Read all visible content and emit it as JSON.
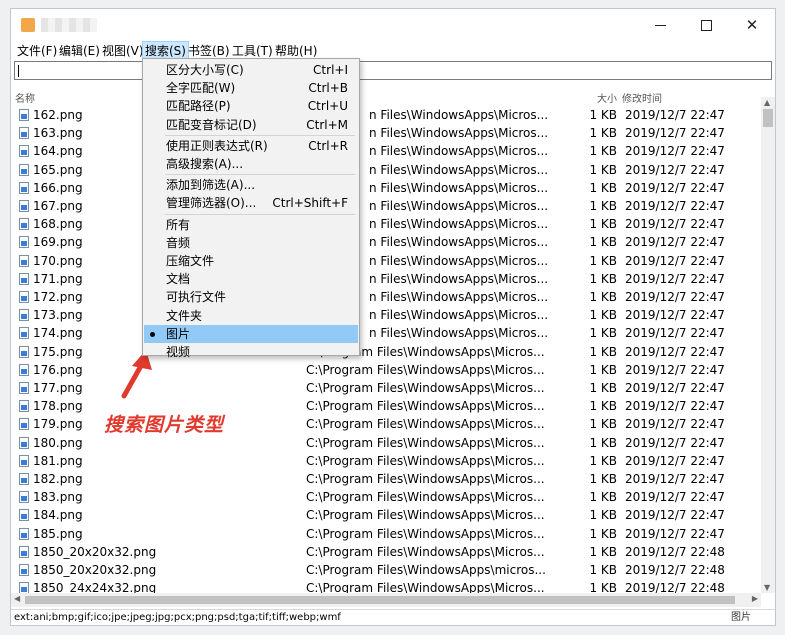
{
  "menubar": {
    "items": [
      {
        "label": "文件(F)",
        "active": false
      },
      {
        "label": "编辑(E)",
        "active": false
      },
      {
        "label": "视图(V)",
        "active": false
      },
      {
        "label": "搜索(S)",
        "active": true
      },
      {
        "label": "书签(B)",
        "active": false
      },
      {
        "label": "工具(T)",
        "active": false
      },
      {
        "label": "帮助(H)",
        "active": false
      }
    ]
  },
  "search": {
    "value": ""
  },
  "columns": {
    "name": "名称",
    "size": "大小",
    "modified": "修改时间"
  },
  "rows": [
    {
      "name": "162.png",
      "path": "n Files\\WindowsApps\\Micros...",
      "size": "1 KB",
      "date": "2019/12/7 22:47"
    },
    {
      "name": "163.png",
      "path": "n Files\\WindowsApps\\Micros...",
      "size": "1 KB",
      "date": "2019/12/7 22:47"
    },
    {
      "name": "164.png",
      "path": "n Files\\WindowsApps\\Micros...",
      "size": "1 KB",
      "date": "2019/12/7 22:47"
    },
    {
      "name": "165.png",
      "path": "n Files\\WindowsApps\\Micros...",
      "size": "1 KB",
      "date": "2019/12/7 22:47"
    },
    {
      "name": "166.png",
      "path": "n Files\\WindowsApps\\Micros...",
      "size": "1 KB",
      "date": "2019/12/7 22:47"
    },
    {
      "name": "167.png",
      "path": "n Files\\WindowsApps\\Micros...",
      "size": "1 KB",
      "date": "2019/12/7 22:47"
    },
    {
      "name": "168.png",
      "path": "n Files\\WindowsApps\\Micros...",
      "size": "1 KB",
      "date": "2019/12/7 22:47"
    },
    {
      "name": "169.png",
      "path": "n Files\\WindowsApps\\Micros...",
      "size": "1 KB",
      "date": "2019/12/7 22:47"
    },
    {
      "name": "170.png",
      "path": "n Files\\WindowsApps\\Micros...",
      "size": "1 KB",
      "date": "2019/12/7 22:47"
    },
    {
      "name": "171.png",
      "path": "n Files\\WindowsApps\\Micros...",
      "size": "1 KB",
      "date": "2019/12/7 22:47"
    },
    {
      "name": "172.png",
      "path": "n Files\\WindowsApps\\Micros...",
      "size": "1 KB",
      "date": "2019/12/7 22:47"
    },
    {
      "name": "173.png",
      "path": "n Files\\WindowsApps\\Micros...",
      "size": "1 KB",
      "date": "2019/12/7 22:47"
    },
    {
      "name": "174.png",
      "path": "n Files\\WindowsApps\\Micros...",
      "size": "1 KB",
      "date": "2019/12/7 22:47"
    },
    {
      "name": "175.png",
      "path": "C:\\Program Files\\WindowsApps\\Micros...",
      "size": "1 KB",
      "date": "2019/12/7 22:47"
    },
    {
      "name": "176.png",
      "path": "C:\\Program Files\\WindowsApps\\Micros...",
      "size": "1 KB",
      "date": "2019/12/7 22:47"
    },
    {
      "name": "177.png",
      "path": "C:\\Program Files\\WindowsApps\\Micros...",
      "size": "1 KB",
      "date": "2019/12/7 22:47"
    },
    {
      "name": "178.png",
      "path": "C:\\Program Files\\WindowsApps\\Micros...",
      "size": "1 KB",
      "date": "2019/12/7 22:47"
    },
    {
      "name": "179.png",
      "path": "C:\\Program Files\\WindowsApps\\Micros...",
      "size": "1 KB",
      "date": "2019/12/7 22:47"
    },
    {
      "name": "180.png",
      "path": "C:\\Program Files\\WindowsApps\\Micros...",
      "size": "1 KB",
      "date": "2019/12/7 22:47"
    },
    {
      "name": "181.png",
      "path": "C:\\Program Files\\WindowsApps\\Micros...",
      "size": "1 KB",
      "date": "2019/12/7 22:47"
    },
    {
      "name": "182.png",
      "path": "C:\\Program Files\\WindowsApps\\Micros...",
      "size": "1 KB",
      "date": "2019/12/7 22:47"
    },
    {
      "name": "183.png",
      "path": "C:\\Program Files\\WindowsApps\\Micros...",
      "size": "1 KB",
      "date": "2019/12/7 22:47"
    },
    {
      "name": "184.png",
      "path": "C:\\Program Files\\WindowsApps\\Micros...",
      "size": "1 KB",
      "date": "2019/12/7 22:47"
    },
    {
      "name": "185.png",
      "path": "C:\\Program Files\\WindowsApps\\Micros...",
      "size": "1 KB",
      "date": "2019/12/7 22:47"
    },
    {
      "name": "1850_20x20x32.png",
      "path": "C:\\Program Files\\WindowsApps\\Micros...",
      "size": "1 KB",
      "date": "2019/12/7 22:48"
    },
    {
      "name": "1850_20x20x32.png",
      "path": "C:\\Program Files\\WindowsApps\\micros...",
      "size": "1 KB",
      "date": "2019/12/7 22:48"
    },
    {
      "name": "1850_24x24x32.png",
      "path": "C:\\Program Files\\WindowsApps\\Micros...",
      "size": "1 KB",
      "date": "2019/12/7 22:48"
    }
  ],
  "dropdown": {
    "groups": [
      {
        "items": [
          {
            "label": "区分大小写(C)",
            "shortcut": "Ctrl+I"
          },
          {
            "label": "全字匹配(W)",
            "shortcut": "Ctrl+B"
          },
          {
            "label": "匹配路径(P)",
            "shortcut": "Ctrl+U"
          },
          {
            "label": "匹配变音标记(D)",
            "shortcut": "Ctrl+M"
          }
        ]
      },
      {
        "items": [
          {
            "label": "使用正则表达式(R)",
            "shortcut": "Ctrl+R"
          },
          {
            "label": "高级搜索(A)...",
            "shortcut": ""
          }
        ]
      },
      {
        "items": [
          {
            "label": "添加到筛选(A)...",
            "shortcut": ""
          },
          {
            "label": "管理筛选器(O)...",
            "shortcut": "Ctrl+Shift+F"
          }
        ]
      },
      {
        "items": [
          {
            "label": "所有",
            "shortcut": ""
          },
          {
            "label": "音频",
            "shortcut": ""
          },
          {
            "label": "压缩文件",
            "shortcut": ""
          },
          {
            "label": "文档",
            "shortcut": ""
          },
          {
            "label": "可执行文件",
            "shortcut": ""
          },
          {
            "label": "文件夹",
            "shortcut": ""
          },
          {
            "label": "图片",
            "shortcut": "",
            "selected": true
          },
          {
            "label": "视频",
            "shortcut": ""
          }
        ]
      }
    ]
  },
  "annotation": {
    "text": "搜索图片类型",
    "color": "#e03a2e"
  },
  "status": {
    "filter": "ext:ani;bmp;gif;ico;jpe;jpeg;jpg;pcx;png;psd;tga;tif;tiff;webp;wmf",
    "type": "图片"
  },
  "window_controls": {
    "minimize": "minimize-icon",
    "maximize": "maximize-icon",
    "close": "close-icon"
  }
}
